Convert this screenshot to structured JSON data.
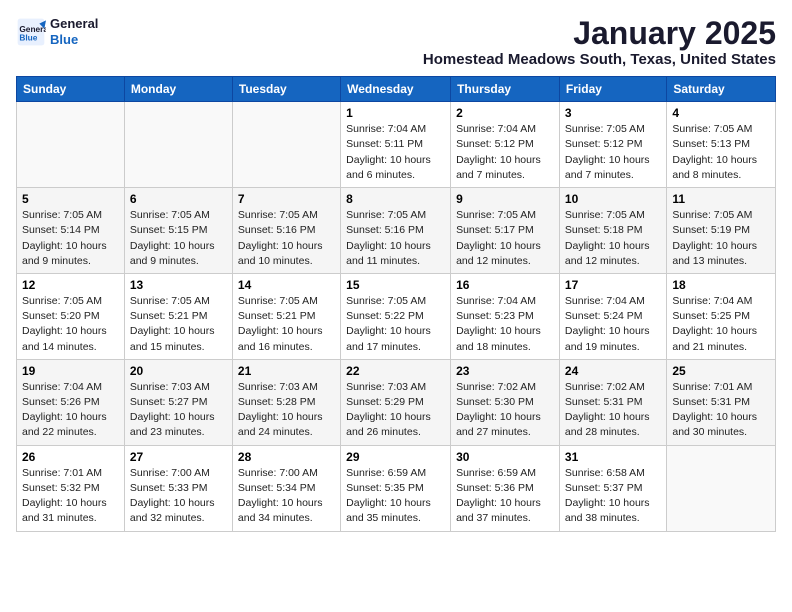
{
  "header": {
    "logo": {
      "line1": "General",
      "line2": "Blue"
    },
    "month": "January 2025",
    "location": "Homestead Meadows South, Texas, United States"
  },
  "days_of_week": [
    "Sunday",
    "Monday",
    "Tuesday",
    "Wednesday",
    "Thursday",
    "Friday",
    "Saturday"
  ],
  "weeks": [
    {
      "days": [
        {
          "num": "",
          "info": ""
        },
        {
          "num": "",
          "info": ""
        },
        {
          "num": "",
          "info": ""
        },
        {
          "num": "1",
          "info": "Sunrise: 7:04 AM\nSunset: 5:11 PM\nDaylight: 10 hours\nand 6 minutes."
        },
        {
          "num": "2",
          "info": "Sunrise: 7:04 AM\nSunset: 5:12 PM\nDaylight: 10 hours\nand 7 minutes."
        },
        {
          "num": "3",
          "info": "Sunrise: 7:05 AM\nSunset: 5:12 PM\nDaylight: 10 hours\nand 7 minutes."
        },
        {
          "num": "4",
          "info": "Sunrise: 7:05 AM\nSunset: 5:13 PM\nDaylight: 10 hours\nand 8 minutes."
        }
      ]
    },
    {
      "days": [
        {
          "num": "5",
          "info": "Sunrise: 7:05 AM\nSunset: 5:14 PM\nDaylight: 10 hours\nand 9 minutes."
        },
        {
          "num": "6",
          "info": "Sunrise: 7:05 AM\nSunset: 5:15 PM\nDaylight: 10 hours\nand 9 minutes."
        },
        {
          "num": "7",
          "info": "Sunrise: 7:05 AM\nSunset: 5:16 PM\nDaylight: 10 hours\nand 10 minutes."
        },
        {
          "num": "8",
          "info": "Sunrise: 7:05 AM\nSunset: 5:16 PM\nDaylight: 10 hours\nand 11 minutes."
        },
        {
          "num": "9",
          "info": "Sunrise: 7:05 AM\nSunset: 5:17 PM\nDaylight: 10 hours\nand 12 minutes."
        },
        {
          "num": "10",
          "info": "Sunrise: 7:05 AM\nSunset: 5:18 PM\nDaylight: 10 hours\nand 12 minutes."
        },
        {
          "num": "11",
          "info": "Sunrise: 7:05 AM\nSunset: 5:19 PM\nDaylight: 10 hours\nand 13 minutes."
        }
      ]
    },
    {
      "days": [
        {
          "num": "12",
          "info": "Sunrise: 7:05 AM\nSunset: 5:20 PM\nDaylight: 10 hours\nand 14 minutes."
        },
        {
          "num": "13",
          "info": "Sunrise: 7:05 AM\nSunset: 5:21 PM\nDaylight: 10 hours\nand 15 minutes."
        },
        {
          "num": "14",
          "info": "Sunrise: 7:05 AM\nSunset: 5:21 PM\nDaylight: 10 hours\nand 16 minutes."
        },
        {
          "num": "15",
          "info": "Sunrise: 7:05 AM\nSunset: 5:22 PM\nDaylight: 10 hours\nand 17 minutes."
        },
        {
          "num": "16",
          "info": "Sunrise: 7:04 AM\nSunset: 5:23 PM\nDaylight: 10 hours\nand 18 minutes."
        },
        {
          "num": "17",
          "info": "Sunrise: 7:04 AM\nSunset: 5:24 PM\nDaylight: 10 hours\nand 19 minutes."
        },
        {
          "num": "18",
          "info": "Sunrise: 7:04 AM\nSunset: 5:25 PM\nDaylight: 10 hours\nand 21 minutes."
        }
      ]
    },
    {
      "days": [
        {
          "num": "19",
          "info": "Sunrise: 7:04 AM\nSunset: 5:26 PM\nDaylight: 10 hours\nand 22 minutes."
        },
        {
          "num": "20",
          "info": "Sunrise: 7:03 AM\nSunset: 5:27 PM\nDaylight: 10 hours\nand 23 minutes."
        },
        {
          "num": "21",
          "info": "Sunrise: 7:03 AM\nSunset: 5:28 PM\nDaylight: 10 hours\nand 24 minutes."
        },
        {
          "num": "22",
          "info": "Sunrise: 7:03 AM\nSunset: 5:29 PM\nDaylight: 10 hours\nand 26 minutes."
        },
        {
          "num": "23",
          "info": "Sunrise: 7:02 AM\nSunset: 5:30 PM\nDaylight: 10 hours\nand 27 minutes."
        },
        {
          "num": "24",
          "info": "Sunrise: 7:02 AM\nSunset: 5:31 PM\nDaylight: 10 hours\nand 28 minutes."
        },
        {
          "num": "25",
          "info": "Sunrise: 7:01 AM\nSunset: 5:31 PM\nDaylight: 10 hours\nand 30 minutes."
        }
      ]
    },
    {
      "days": [
        {
          "num": "26",
          "info": "Sunrise: 7:01 AM\nSunset: 5:32 PM\nDaylight: 10 hours\nand 31 minutes."
        },
        {
          "num": "27",
          "info": "Sunrise: 7:00 AM\nSunset: 5:33 PM\nDaylight: 10 hours\nand 32 minutes."
        },
        {
          "num": "28",
          "info": "Sunrise: 7:00 AM\nSunset: 5:34 PM\nDaylight: 10 hours\nand 34 minutes."
        },
        {
          "num": "29",
          "info": "Sunrise: 6:59 AM\nSunset: 5:35 PM\nDaylight: 10 hours\nand 35 minutes."
        },
        {
          "num": "30",
          "info": "Sunrise: 6:59 AM\nSunset: 5:36 PM\nDaylight: 10 hours\nand 37 minutes."
        },
        {
          "num": "31",
          "info": "Sunrise: 6:58 AM\nSunset: 5:37 PM\nDaylight: 10 hours\nand 38 minutes."
        },
        {
          "num": "",
          "info": ""
        }
      ]
    }
  ]
}
